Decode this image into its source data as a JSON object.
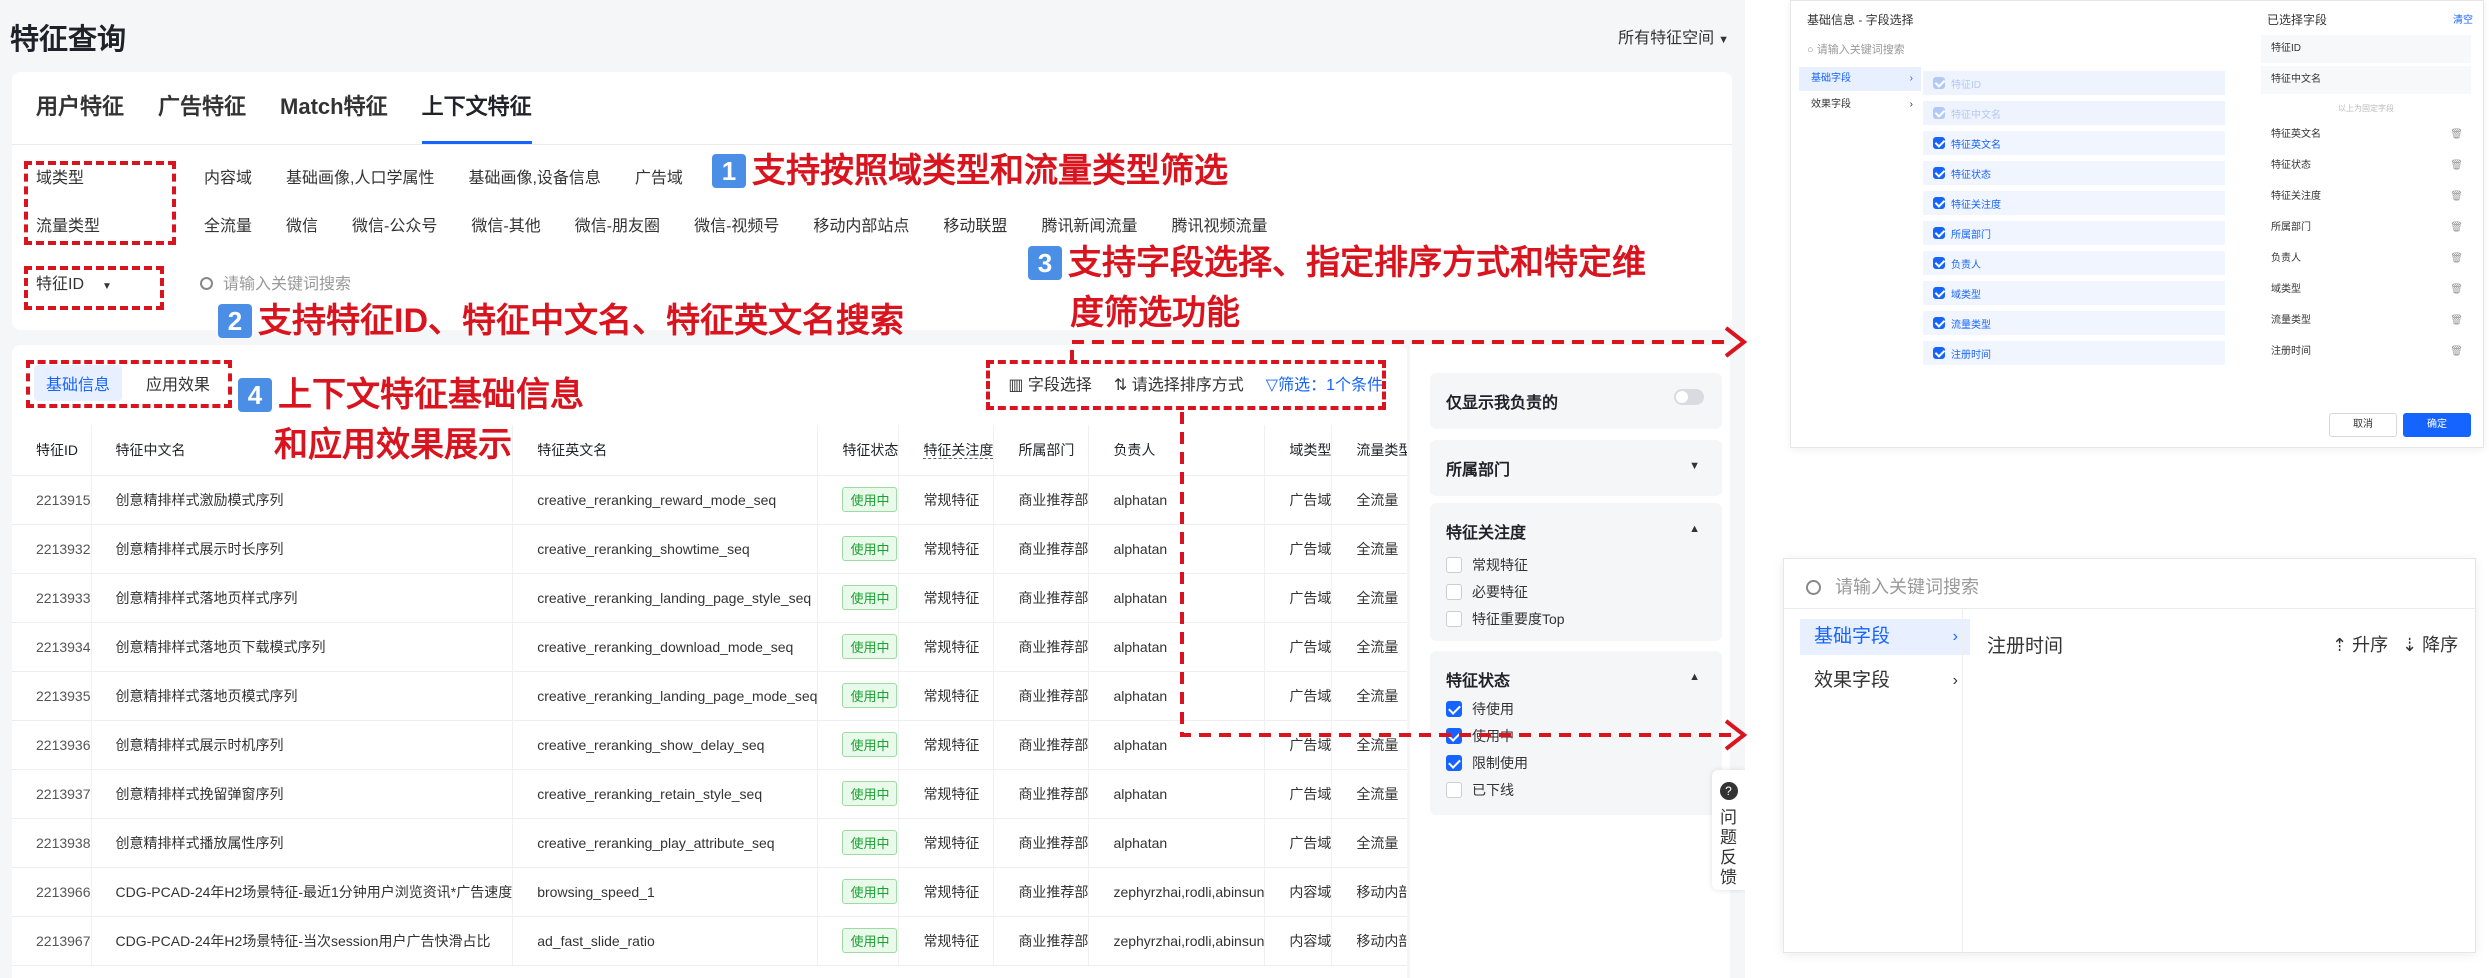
{
  "page": {
    "title": "特征查询",
    "space_selector": "所有特征空间"
  },
  "main_tabs": [
    "用户特征",
    "广告特征",
    "Match特征",
    "上下文特征"
  ],
  "filters": {
    "domain": {
      "label": "域类型",
      "options": [
        "内容域",
        "基础画像,人口学属性",
        "基础画像,设备信息",
        "广告域"
      ]
    },
    "traffic": {
      "label": "流量类型",
      "options": [
        "全流量",
        "微信",
        "微信-公众号",
        "微信-其他",
        "微信-朋友圈",
        "微信-视频号",
        "移动内部站点",
        "移动联盟",
        "腾讯新闻流量",
        "腾讯视频流量"
      ]
    }
  },
  "search": {
    "select": "特征ID",
    "placeholder": "请输入关键词搜索"
  },
  "sub_tabs": [
    "基础信息",
    "应用效果"
  ],
  "toolbar": {
    "fields": "字段选择",
    "sort": "请选择排序方式",
    "filter": "筛选：1个条件"
  },
  "table": {
    "headers": [
      "特征ID",
      "特征中文名",
      "特征英文名",
      "特征状态",
      "特征关注度",
      "所属部门",
      "负责人",
      "域类型",
      "流量类型"
    ],
    "rows": [
      [
        "2213915",
        "创意精排样式激励模式序列",
        "creative_reranking_reward_mode_seq",
        "使用中",
        "常规特征",
        "商业推荐部",
        "alphatan",
        "广告域",
        "全流量"
      ],
      [
        "2213932",
        "创意精排样式展示时长序列",
        "creative_reranking_showtime_seq",
        "使用中",
        "常规特征",
        "商业推荐部",
        "alphatan",
        "广告域",
        "全流量"
      ],
      [
        "2213933",
        "创意精排样式落地页样式序列",
        "creative_reranking_landing_page_style_seq",
        "使用中",
        "常规特征",
        "商业推荐部",
        "alphatan",
        "广告域",
        "全流量"
      ],
      [
        "2213934",
        "创意精排样式落地页下载模式序列",
        "creative_reranking_download_mode_seq",
        "使用中",
        "常规特征",
        "商业推荐部",
        "alphatan",
        "广告域",
        "全流量"
      ],
      [
        "2213935",
        "创意精排样式落地页模式序列",
        "creative_reranking_landing_page_mode_seq",
        "使用中",
        "常规特征",
        "商业推荐部",
        "alphatan",
        "广告域",
        "全流量"
      ],
      [
        "2213936",
        "创意精排样式展示时机序列",
        "creative_reranking_show_delay_seq",
        "使用中",
        "常规特征",
        "商业推荐部",
        "alphatan",
        "广告域",
        "全流量"
      ],
      [
        "2213937",
        "创意精排样式挽留弹窗序列",
        "creative_reranking_retain_style_seq",
        "使用中",
        "常规特征",
        "商业推荐部",
        "alphatan",
        "广告域",
        "全流量"
      ],
      [
        "2213938",
        "创意精排样式播放属性序列",
        "creative_reranking_play_attribute_seq",
        "使用中",
        "常规特征",
        "商业推荐部",
        "alphatan",
        "广告域",
        "全流量"
      ],
      [
        "2213966",
        "CDG-PCAD-24年H2场景特征-最近1分钟用户浏览资讯*广告速度",
        "browsing_speed_1",
        "使用中",
        "常规特征",
        "商业推荐部",
        "zephyrzhai,rodli,abinsun",
        "内容域",
        "移动内部"
      ],
      [
        "2213967",
        "CDG-PCAD-24年H2场景特征-当次session用户广告快滑占比",
        "ad_fast_slide_ratio",
        "使用中",
        "常规特征",
        "商业推荐部",
        "zephyrzhai,rodli,abinsun",
        "内容域",
        "移动内部"
      ]
    ]
  },
  "filter_panel": {
    "only_mine": "仅显示我负责的",
    "department": "所属部门",
    "attention": {
      "title": "特征关注度",
      "options": [
        "常规特征",
        "必要特征",
        "特征重要度Top"
      ]
    },
    "status": {
      "title": "特征状态",
      "options": [
        {
          "label": "待使用",
          "checked": true
        },
        {
          "label": "使用中",
          "checked": true
        },
        {
          "label": "限制使用",
          "checked": true
        },
        {
          "label": "已下线",
          "checked": false
        }
      ]
    }
  },
  "feedback": "问题反馈",
  "annotations": {
    "a1": {
      "num": "1",
      "text": "支持按照域类型和流量类型筛选"
    },
    "a2": {
      "num": "2",
      "text": "支持特征ID、特征中文名、特征英文名搜索"
    },
    "a3": {
      "num": "3",
      "line1": "支持字段选择、指定排序方式和特定维",
      "line2": "度筛选功能"
    },
    "a4": {
      "num": "4",
      "line1": "上下文特征基础信息",
      "line2": "和应用效果展示"
    }
  },
  "modal": {
    "title": "基础信息 - 字段选择",
    "search_placeholder": "请输入关键词搜索",
    "categories": [
      "基础字段",
      "效果字段"
    ],
    "fields": [
      {
        "label": "特征ID",
        "disabled": true
      },
      {
        "label": "特征中文名",
        "disabled": true
      },
      {
        "label": "特征英文名",
        "disabled": false
      },
      {
        "label": "特征状态",
        "disabled": false
      },
      {
        "label": "特征关注度",
        "disabled": false
      },
      {
        "label": "所属部门",
        "disabled": false
      },
      {
        "label": "负责人",
        "disabled": false
      },
      {
        "label": "域类型",
        "disabled": false
      },
      {
        "label": "流量类型",
        "disabled": false
      },
      {
        "label": "注册时间",
        "disabled": false
      }
    ],
    "selected_title": "已选择字段",
    "clear": "清空",
    "fixed_fields": [
      "特征ID",
      "特征中文名"
    ],
    "fixed_note": "以上为固定字段",
    "selected_fields": [
      "特征英文名",
      "特征状态",
      "特征关注度",
      "所属部门",
      "负责人",
      "域类型",
      "流量类型",
      "注册时间"
    ],
    "cancel": "取消",
    "ok": "确定"
  },
  "sort_panel": {
    "placeholder": "请输入关键词搜索",
    "categories": [
      "基础字段",
      "效果字段"
    ],
    "field": "注册时间",
    "asc": "升序",
    "desc": "降序"
  },
  "colors": {
    "accent": "#1664ff",
    "annotation_red": "#d9141e",
    "tag_green": "#19a332"
  }
}
